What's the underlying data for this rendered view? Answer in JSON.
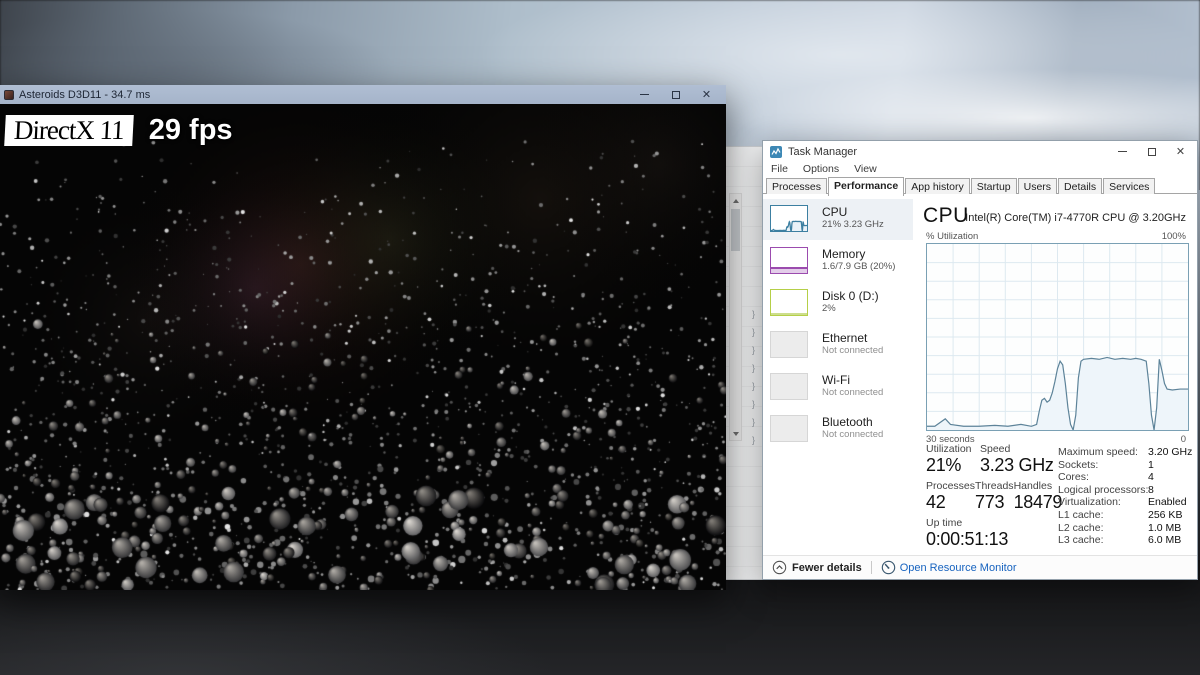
{
  "colors": {
    "cpu_accent": "#3c7fa1",
    "memory_accent": "#9b4bae",
    "disk_accent": "#b5cf48",
    "link_blue": "#1763bf",
    "game_titlebar": "#a9b8ce"
  },
  "game_window": {
    "title": "Asteroids D3D11 - 34.7 ms",
    "overlay": {
      "api": "DirectX 11",
      "fps": "29 fps"
    }
  },
  "background_window": {
    "glyph": "}",
    "glyph_count": 8
  },
  "task_manager": {
    "title": "Task Manager",
    "menu": [
      "File",
      "Options",
      "View"
    ],
    "tabs": [
      {
        "label": "Processes",
        "active": false
      },
      {
        "label": "Performance",
        "active": true
      },
      {
        "label": "App history",
        "active": false
      },
      {
        "label": "Startup",
        "active": false
      },
      {
        "label": "Users",
        "active": false
      },
      {
        "label": "Details",
        "active": false
      },
      {
        "label": "Services",
        "active": false
      }
    ],
    "sidebar": [
      {
        "label": "CPU",
        "detail": "21% 3.23 GHz",
        "kind": "cpu",
        "selected": true
      },
      {
        "label": "Memory",
        "detail": "1.6/7.9 GB (20%)",
        "kind": "memory",
        "selected": false
      },
      {
        "label": "Disk 0 (D:)",
        "detail": "2%",
        "kind": "disk",
        "selected": false
      },
      {
        "label": "Ethernet",
        "detail": "Not connected",
        "kind": "plain",
        "selected": false
      },
      {
        "label": "Wi-Fi",
        "detail": "Not connected",
        "kind": "plain",
        "selected": false
      },
      {
        "label": "Bluetooth",
        "detail": "Not connected",
        "kind": "plain",
        "selected": false
      }
    ],
    "cpu_panel": {
      "heading": "CPU",
      "subtitle": "Intel(R) Core(TM) i7-4770R CPU @ 3.20GHz",
      "graph": {
        "type": "area",
        "y_axis_label": "% Utilization",
        "y_max_label": "100%",
        "x_left_label": "30 seconds",
        "x_right_label": "0",
        "ylim": [
          0,
          100
        ],
        "history_pct": [
          [
            0,
            2
          ],
          [
            3,
            2
          ],
          [
            7,
            6
          ],
          [
            9,
            3
          ],
          [
            14,
            2
          ],
          [
            20,
            2
          ],
          [
            26,
            2.5
          ],
          [
            31,
            2
          ],
          [
            36,
            3
          ],
          [
            40,
            2
          ],
          [
            42,
            3
          ],
          [
            43,
            10
          ],
          [
            44,
            16
          ],
          [
            45,
            17
          ],
          [
            46,
            15
          ],
          [
            47,
            16
          ],
          [
            48,
            20
          ],
          [
            49,
            26
          ],
          [
            50,
            33
          ],
          [
            51,
            37
          ],
          [
            52,
            35
          ],
          [
            53,
            25
          ],
          [
            54,
            12
          ],
          [
            55,
            3
          ],
          [
            56,
            0
          ],
          [
            57,
            8
          ],
          [
            58,
            28
          ],
          [
            59,
            37
          ],
          [
            60,
            38
          ],
          [
            63,
            38.5
          ],
          [
            66,
            38
          ],
          [
            69,
            39
          ],
          [
            72,
            38
          ],
          [
            75,
            38.5
          ],
          [
            78,
            38
          ],
          [
            80,
            38.5
          ],
          [
            82,
            38
          ],
          [
            84,
            37
          ],
          [
            85,
            25
          ],
          [
            86,
            8
          ],
          [
            87,
            0
          ],
          [
            88,
            12
          ],
          [
            89,
            38
          ],
          [
            90,
            32
          ],
          [
            91,
            25
          ],
          [
            92,
            22
          ],
          [
            94,
            21.5
          ],
          [
            97,
            22
          ],
          [
            100,
            22
          ]
        ]
      },
      "stats_rows": [
        [
          {
            "label": "Utilization",
            "value": "21%"
          },
          {
            "label": "Speed",
            "value": "3.23 GHz"
          }
        ],
        [
          {
            "label": "Processes",
            "value": "42"
          },
          {
            "label": "Threads",
            "value": "773"
          },
          {
            "label": "Handles",
            "value": "18479"
          }
        ],
        [
          {
            "label": "Up time",
            "value": "0:00:51:13"
          }
        ]
      ],
      "details": [
        {
          "label": "Maximum speed:",
          "value": "3.20 GHz"
        },
        {
          "label": "Sockets:",
          "value": "1"
        },
        {
          "label": "Cores:",
          "value": "4"
        },
        {
          "label": "Logical processors:",
          "value": "8"
        },
        {
          "label": "Virtualization:",
          "value": "Enabled"
        },
        {
          "label": "L1 cache:",
          "value": "256 KB"
        },
        {
          "label": "L2 cache:",
          "value": "1.0 MB"
        },
        {
          "label": "L3 cache:",
          "value": "6.0 MB"
        }
      ]
    },
    "footer": {
      "fewer_details": "Fewer details",
      "open_resource_monitor": "Open Resource Monitor"
    }
  },
  "icons": {
    "close": "✕"
  }
}
